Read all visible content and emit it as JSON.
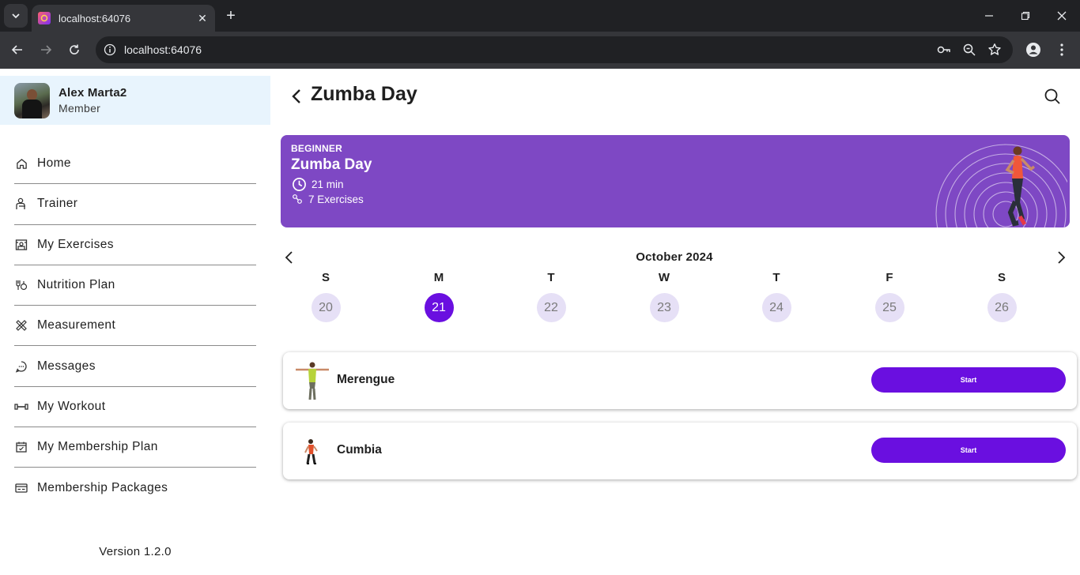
{
  "browser": {
    "tab_title": "localhost:64076",
    "url": "localhost:64076"
  },
  "sidebar": {
    "user_name": "Alex Marta2",
    "user_role": "Member",
    "items": [
      {
        "label": "Home",
        "icon": "home-icon"
      },
      {
        "label": "Trainer",
        "icon": "trainer-icon"
      },
      {
        "label": "My Exercises",
        "icon": "exercise-machine-icon"
      },
      {
        "label": "Nutrition Plan",
        "icon": "nutrition-icon"
      },
      {
        "label": "Measurement",
        "icon": "measure-tape-icon"
      },
      {
        "label": "Messages",
        "icon": "chat-bubble-icon"
      },
      {
        "label": "My Workout",
        "icon": "dumbbell-icon"
      },
      {
        "label": "My Membership Plan",
        "icon": "calendar-check-icon"
      },
      {
        "label": "Membership Packages",
        "icon": "id-card-icon"
      }
    ],
    "version": "Version 1.2.0"
  },
  "header": {
    "title": "Zumba Day"
  },
  "banner": {
    "level": "BEGINNER",
    "title": "Zumba Day",
    "duration": "21 min",
    "exercises": "7 Exercises",
    "bg_color": "#7e48c4"
  },
  "calendar": {
    "month": "October 2024",
    "days": [
      {
        "name": "S",
        "date": "20",
        "selected": false
      },
      {
        "name": "M",
        "date": "21",
        "selected": true
      },
      {
        "name": "T",
        "date": "22",
        "selected": false
      },
      {
        "name": "W",
        "date": "23",
        "selected": false
      },
      {
        "name": "T",
        "date": "24",
        "selected": false
      },
      {
        "name": "F",
        "date": "25",
        "selected": false
      },
      {
        "name": "S",
        "date": "26",
        "selected": false
      }
    ],
    "accent": "#6a0fe0"
  },
  "exercises": [
    {
      "name": "Merengue",
      "button": "Start"
    },
    {
      "name": "Cumbia",
      "button": "Start"
    }
  ]
}
